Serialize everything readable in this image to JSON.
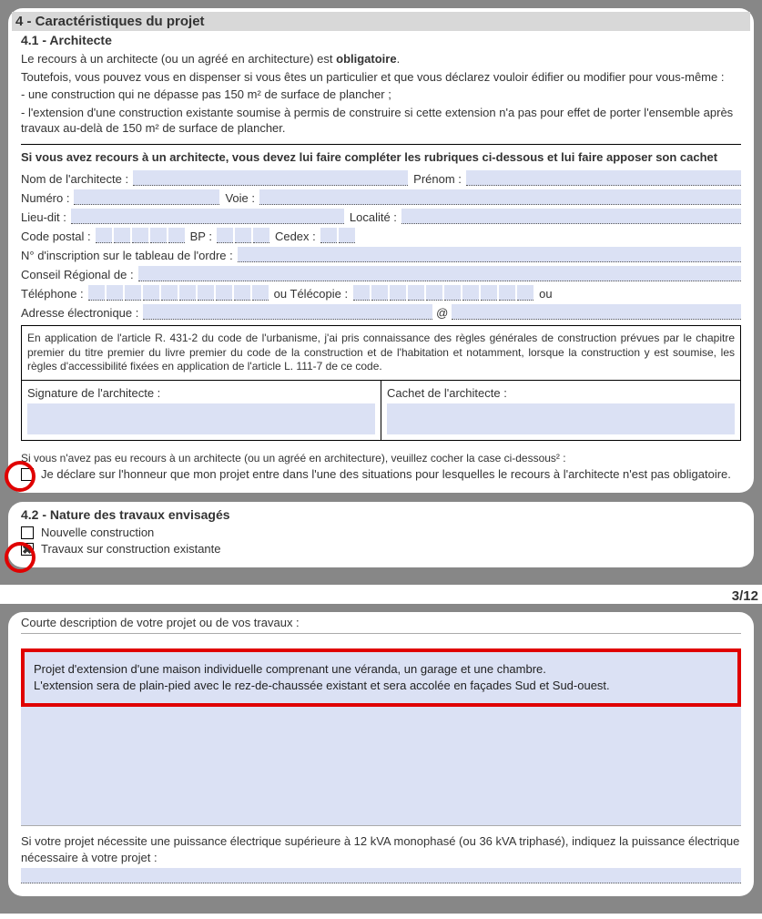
{
  "section4": {
    "title": "4 - Caractéristiques du projet",
    "s4_1_title": "4.1 - Architecte",
    "p1a": "Le recours à un architecte (ou un agréé en architecture) est ",
    "p1b": "obligatoire",
    "p1c": ".",
    "p2": "Toutefois, vous pouvez vous en dispenser si vous êtes un particulier et que vous déclarez vouloir édifier ou modifier pour vous-même :",
    "p3": "- une construction qui ne dépasse pas 150 m² de surface de plancher ;",
    "p4": "- l'extension d'une construction existante soumise à permis de construire si cette extension n'a pas pour effet de porter l'ensemble après travaux au-delà de 150 m² de surface de plancher.",
    "bold_block": "Si vous avez recours à un architecte, vous devez lui faire compléter les rubriques ci-dessous et lui faire apposer son cachet",
    "labels": {
      "nom": "Nom de l'architecte :",
      "prenom": "Prénom :",
      "numero": "Numéro :",
      "voie": "Voie :",
      "lieudit": "Lieu-dit :",
      "localite": "Localité :",
      "cp": "Code postal :",
      "bp": "BP :",
      "cedex": "Cedex :",
      "inscription": "N° d'inscription sur le tableau de l'ordre :",
      "conseil": "Conseil Régional de :",
      "tel": "Téléphone :",
      "ou1": "ou Télécopie :",
      "ou2": "ou",
      "email": "Adresse électronique :",
      "at": "@"
    },
    "legal": "En application de l'article R. 431-2 du code de l'urbanisme, j'ai pris connaissance des règles générales de construction prévues par le chapitre premier du titre premier du livre premier du code de la construction et de l'habitation et notamment, lorsque la construction y est soumise, les règles d'accessibilité fixées en application de l'article L. 111-7 de ce code.",
    "sig": "Signature de l'architecte :",
    "cachet": "Cachet de l'architecte :",
    "no_arch_note": "Si vous n'avez pas eu recours à un architecte (ou un agréé en architecture), veuillez cocher la case ci-dessous² :",
    "no_arch_decl": "Je déclare sur l'honneur que mon projet entre dans l'une des situations pour lesquelles le recours à l'architecte n'est pas obligatoire."
  },
  "section4_2": {
    "title": "4.2 - Nature des travaux envisagés",
    "opt1": "Nouvelle construction",
    "opt2": "Travaux sur construction existante"
  },
  "pager": "3/12",
  "desc": {
    "label": "Courte description de votre projet ou de vos travaux :",
    "line1": "Projet d'extension d'une maison individuelle comprenant une véranda, un garage et une chambre.",
    "line2": "L'extension sera de plain-pied avec le rez-de-chaussée existant et sera accolée en façades Sud et Sud-ouest.",
    "power_note": "Si votre projet nécessite une puissance électrique supérieure à 12 kVA monophasé (ou 36 kVA triphasé), indiquez la puissance électrique nécessaire à votre projet :"
  }
}
